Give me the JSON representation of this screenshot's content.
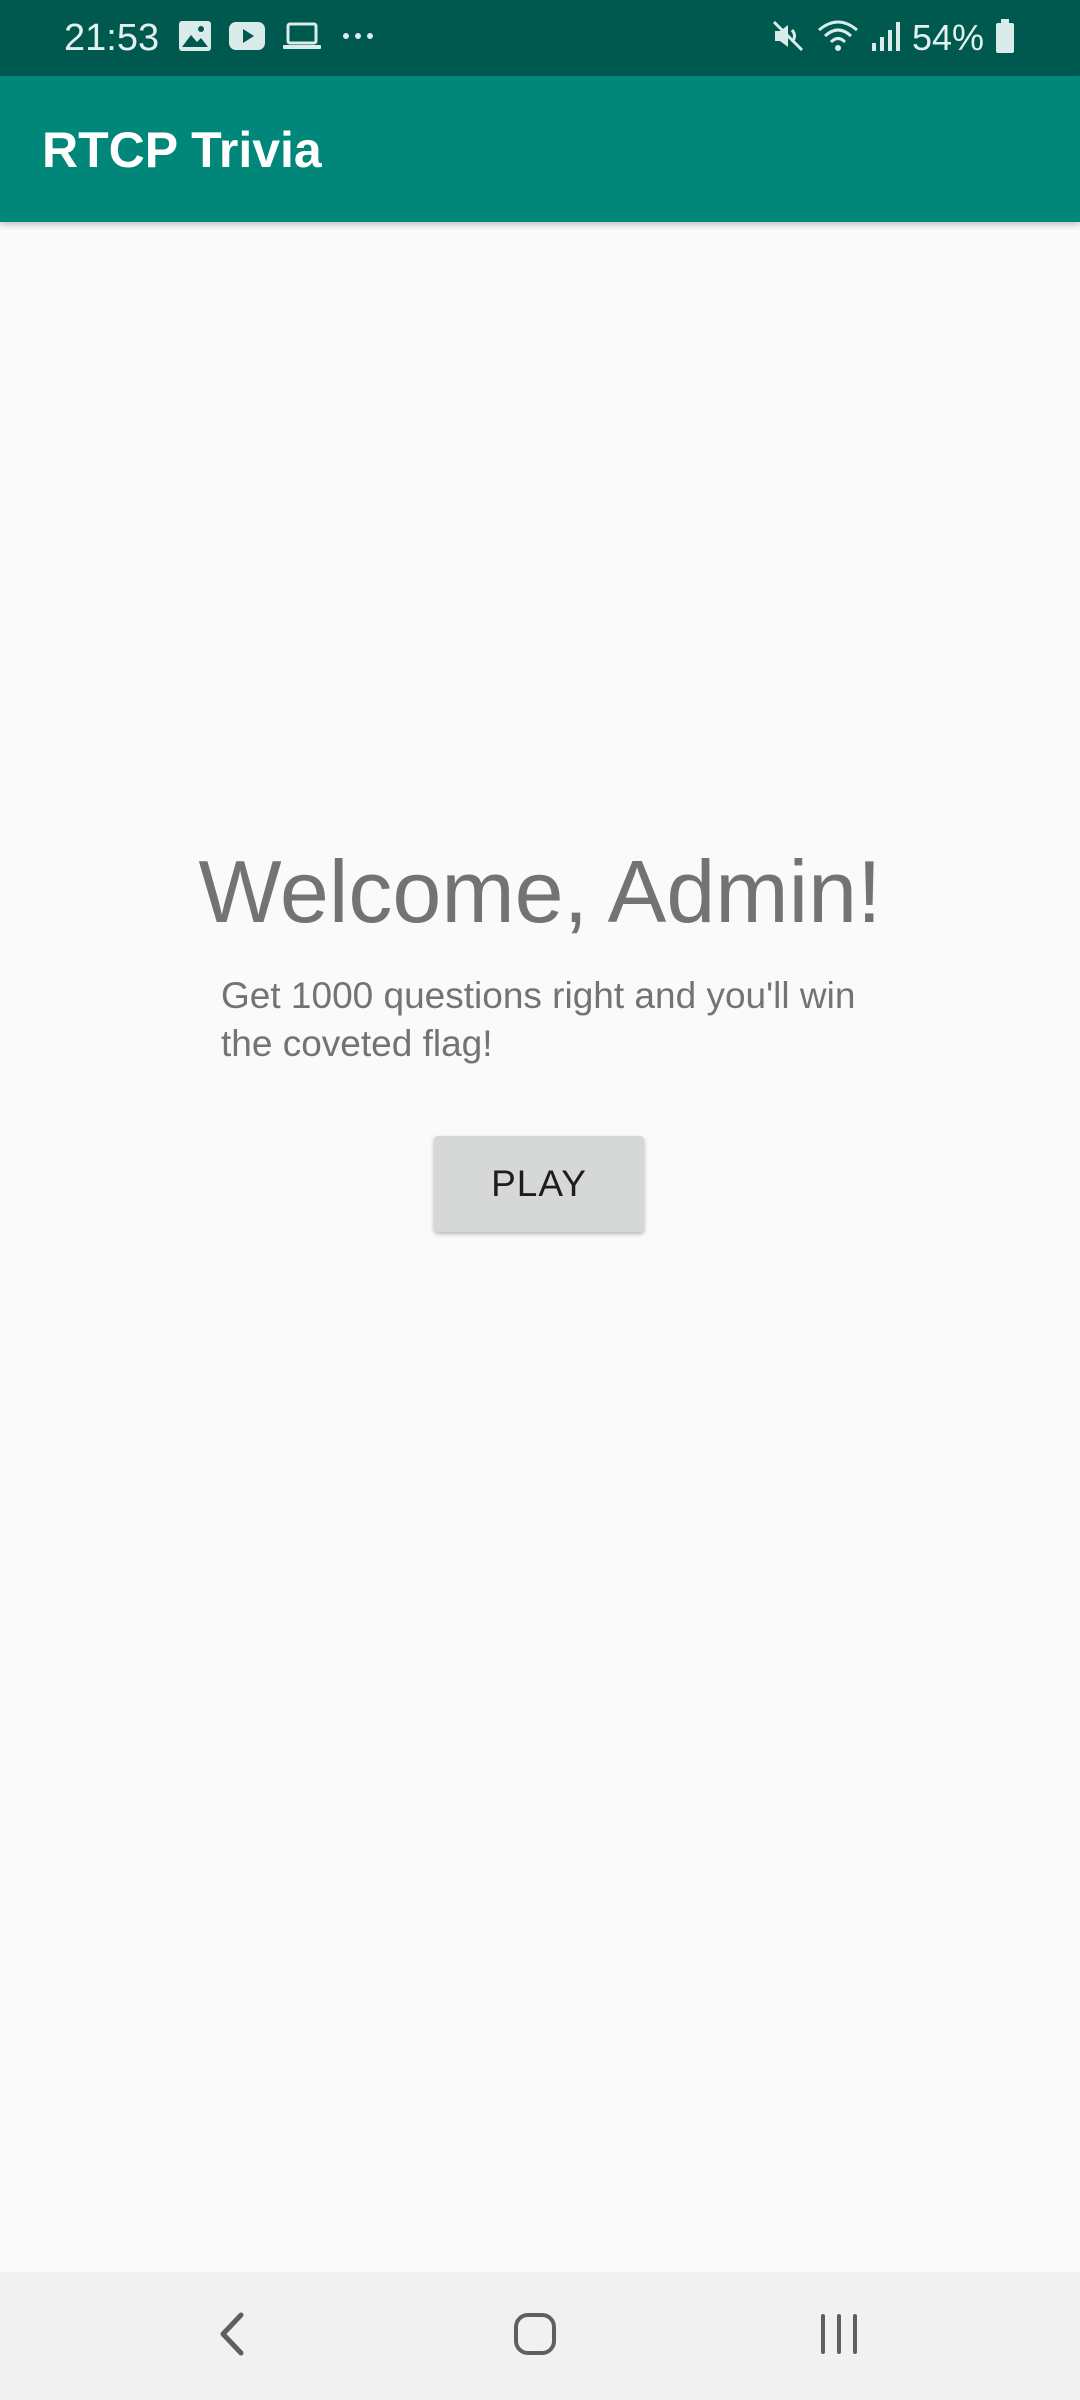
{
  "status_bar": {
    "time": "21:53",
    "left_icons": [
      "image-icon",
      "youtube-icon",
      "laptop-icon",
      "more-dots-icon"
    ],
    "right_icons": [
      "mute-icon",
      "wifi-icon",
      "signal-icon",
      "battery-icon"
    ],
    "battery": "54%"
  },
  "app_bar": {
    "title": "RTCP Trivia"
  },
  "main": {
    "welcome": "Welcome, Admin!",
    "subtitle": "Get 1000 questions right and you'll win the coveted flag!",
    "play_label": "PLAY"
  },
  "nav_bar": {
    "buttons": [
      "back-icon",
      "home-icon",
      "recents-icon"
    ]
  },
  "colors": {
    "status_bar": "#00594f",
    "app_bar": "#00877a",
    "background": "#fafafa",
    "text_gray": "#737373",
    "button": "#d6d7d7"
  }
}
